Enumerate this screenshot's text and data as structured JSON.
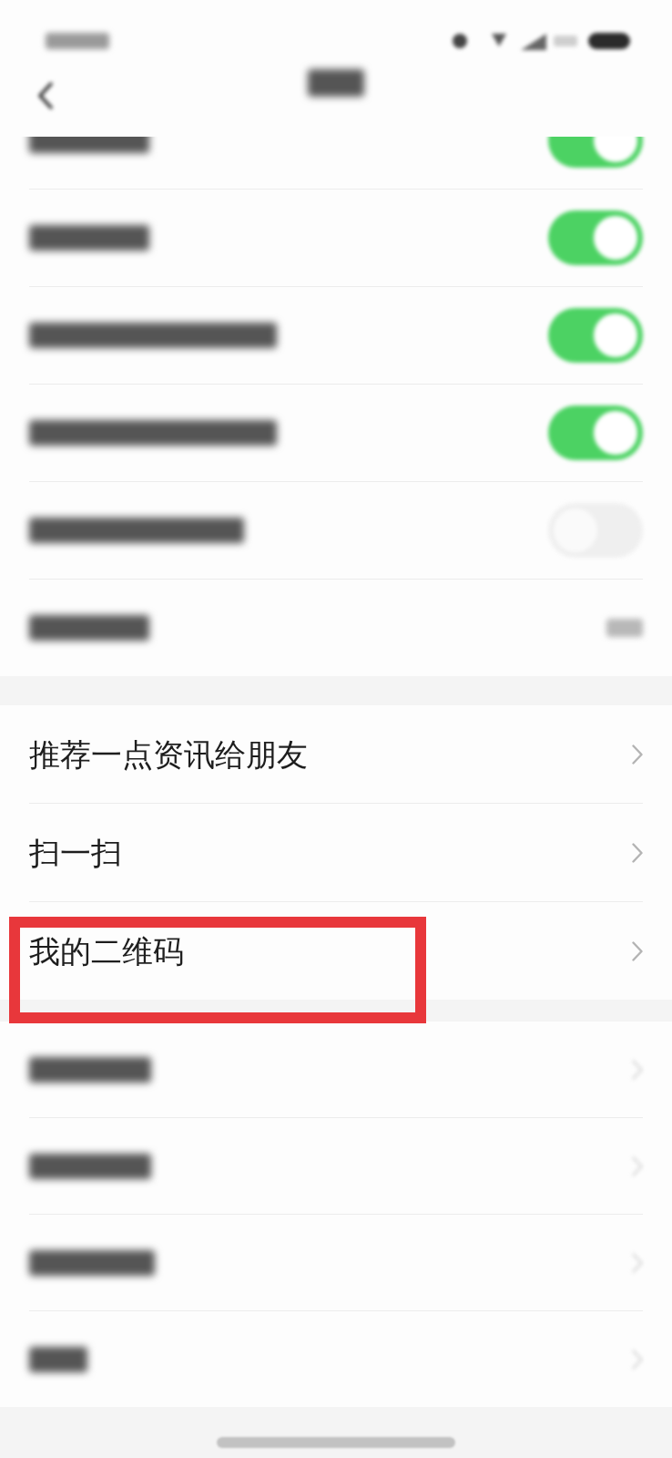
{
  "top_settings": [
    {
      "kind": "toggle",
      "on": true
    },
    {
      "kind": "toggle",
      "on": true
    },
    {
      "kind": "toggle",
      "on": true
    },
    {
      "kind": "toggle",
      "on": true
    },
    {
      "kind": "toggle",
      "on": false
    },
    {
      "kind": "value"
    }
  ],
  "share_menu": [
    {
      "label": "推荐一点资讯给朋友",
      "highlighted": false
    },
    {
      "label": "扫一扫",
      "highlighted": false
    },
    {
      "label": "我的二维码",
      "highlighted": true
    }
  ],
  "other_menu": [
    {
      "kind": "link"
    },
    {
      "kind": "link"
    },
    {
      "kind": "link"
    },
    {
      "kind": "link"
    }
  ]
}
